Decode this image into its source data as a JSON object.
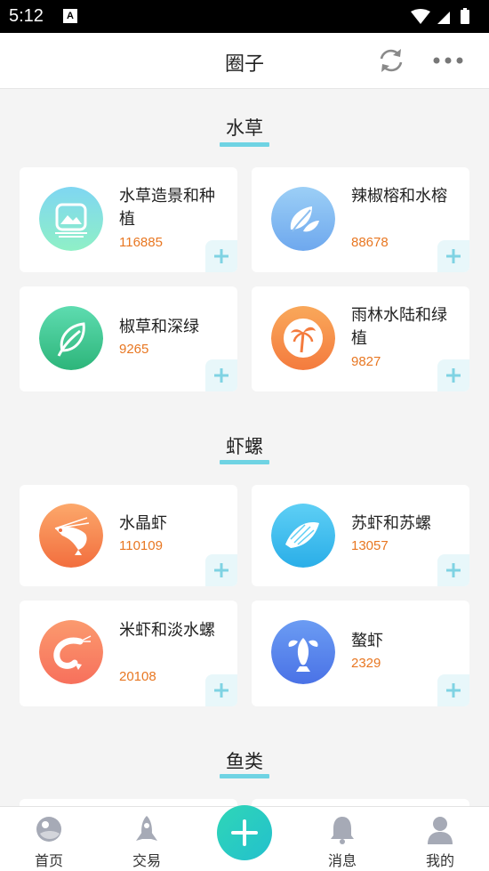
{
  "status": {
    "time": "5:12"
  },
  "header": {
    "title": "圈子"
  },
  "sections": [
    {
      "title": "水草",
      "items": [
        {
          "name": "水草造景和种植",
          "count": "116885"
        },
        {
          "name": "辣椒榕和水榕",
          "count": "88678"
        },
        {
          "name": "椒草和深绿",
          "count": "9265"
        },
        {
          "name": "雨林水陆和绿植",
          "count": "9827"
        }
      ]
    },
    {
      "title": "虾螺",
      "items": [
        {
          "name": "水晶虾",
          "count": "110109"
        },
        {
          "name": "苏虾和苏螺",
          "count": "13057"
        },
        {
          "name": "米虾和淡水螺",
          "count": "20108"
        },
        {
          "name": "螯虾",
          "count": "2329"
        }
      ]
    },
    {
      "title": "鱼类"
    }
  ],
  "tabbar": {
    "home": "首页",
    "trade": "交易",
    "messages": "消息",
    "mine": "我的"
  },
  "icons": {
    "aquascape": "landscape-icon",
    "leaf_pair": "leaves-icon",
    "leaf_single": "leaf-icon",
    "palm": "palm-tree-icon",
    "shrimp": "shrimp-icon",
    "snail": "snail-icon",
    "curled_shrimp": "curled-shrimp-icon",
    "lobster": "lobster-icon"
  },
  "colors": {
    "accent": "#6fd3e3",
    "count": "#e87722",
    "fab": "#2fd6b7"
  }
}
